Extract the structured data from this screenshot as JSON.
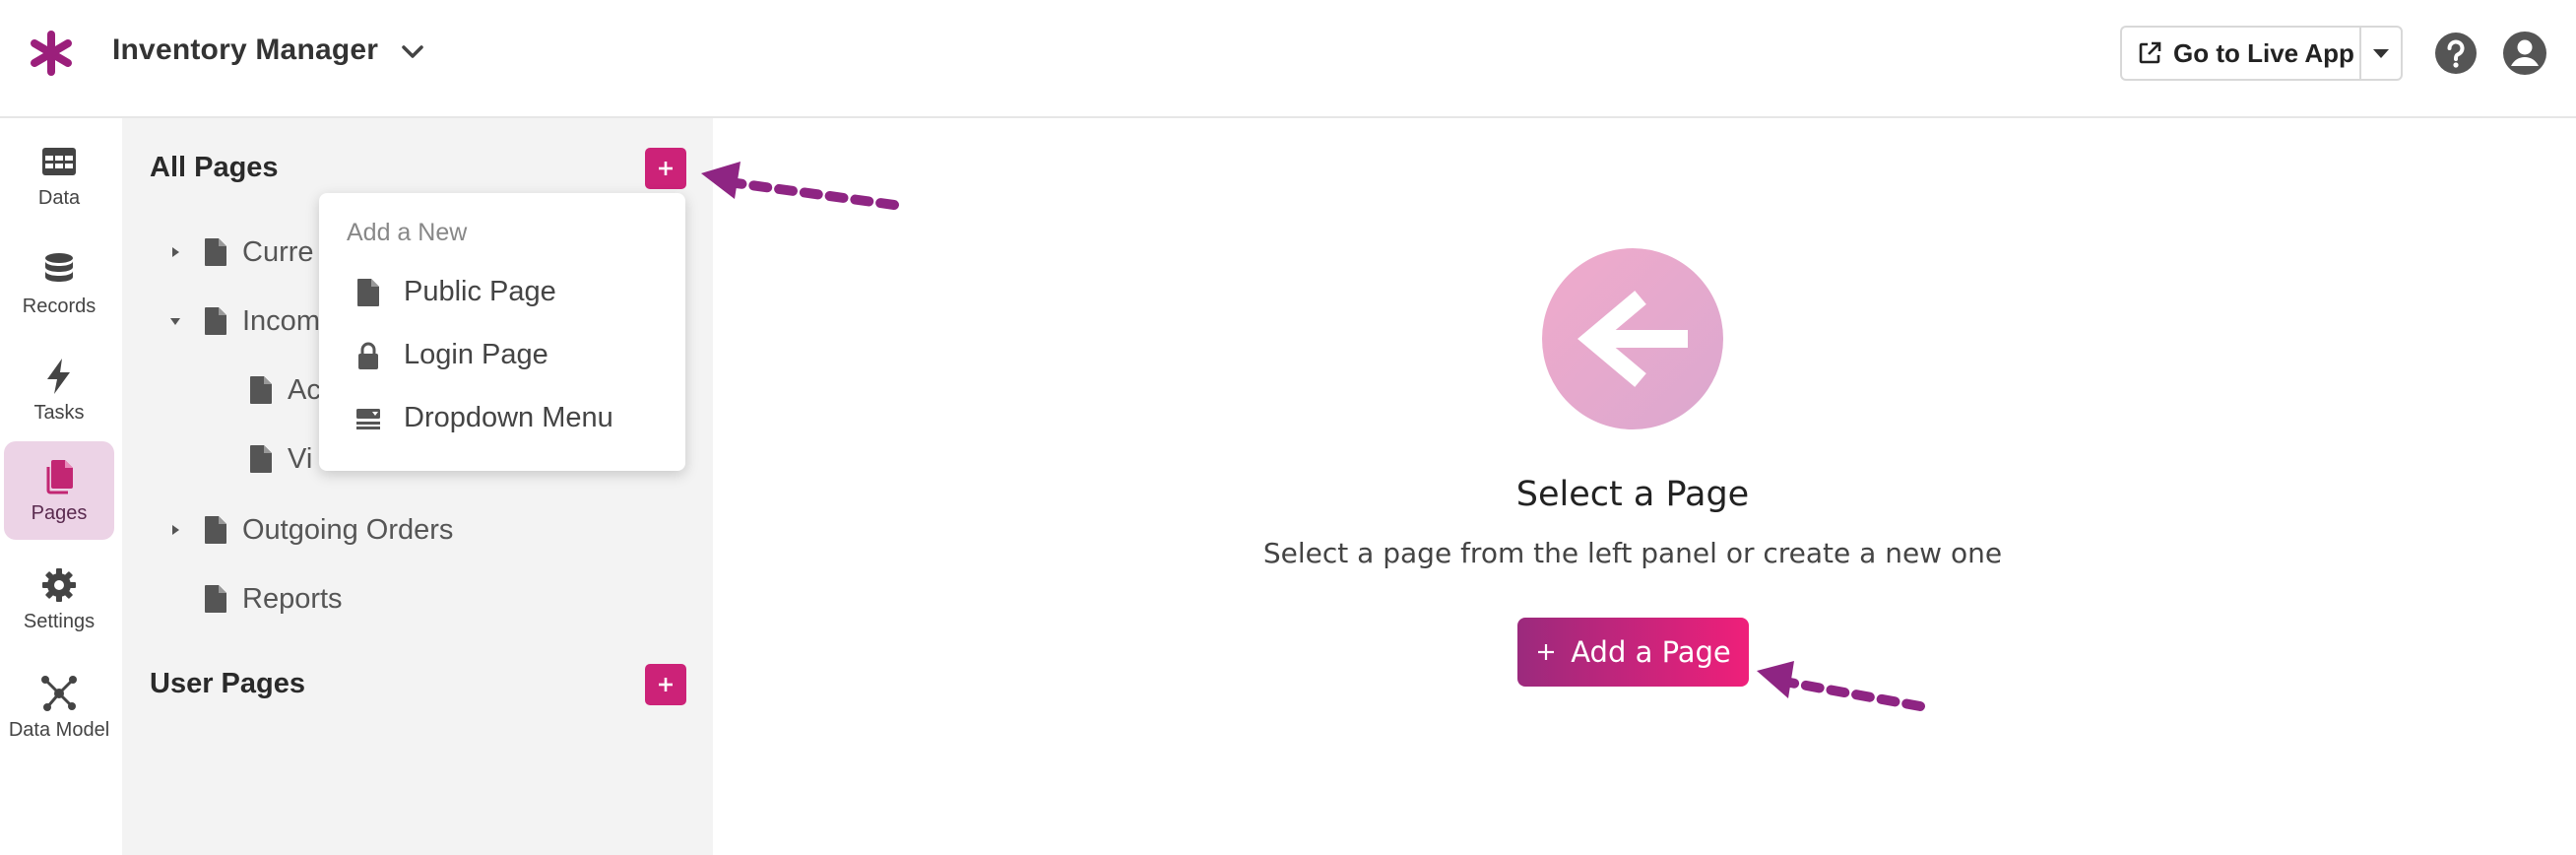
{
  "header": {
    "app_title": "Inventory Manager",
    "live_button_label": "Go to Live App",
    "icons": [
      "asterisk-logo-icon",
      "chevron-down-icon",
      "external-link-icon",
      "caret-down-icon",
      "help-icon",
      "user-account-icon"
    ]
  },
  "leftnav": {
    "items": [
      {
        "label": "Data",
        "icon": "table-icon",
        "active": false
      },
      {
        "label": "Records",
        "icon": "database-icon",
        "active": false
      },
      {
        "label": "Tasks",
        "icon": "bolt-icon",
        "active": false
      },
      {
        "label": "Pages",
        "icon": "pages-icon",
        "active": true
      },
      {
        "label": "Settings",
        "icon": "gear-icon",
        "active": false
      },
      {
        "label": "Data Model",
        "icon": "nodes-icon",
        "active": false
      }
    ]
  },
  "pages_panel": {
    "all_pages_title": "All Pages",
    "user_pages_title": "User Pages",
    "tree": [
      {
        "label": "Curre",
        "expanded": false
      },
      {
        "label": "Incom",
        "expanded": true
      },
      {
        "label": "Ac"
      },
      {
        "label": "Vi"
      },
      {
        "label": "Outgoing Orders",
        "expanded": false
      },
      {
        "label": "Reports"
      }
    ]
  },
  "add_menu": {
    "title": "Add a New",
    "items": [
      {
        "label": "Public Page",
        "icon": "document-icon"
      },
      {
        "label": "Login Page",
        "icon": "lock-icon"
      },
      {
        "label": "Dropdown Menu",
        "icon": "dropdown-menu-icon"
      }
    ]
  },
  "main": {
    "empty_title": "Select a Page",
    "empty_subtitle": "Select a page from the left panel or create a new one",
    "add_button_label": "Add a Page"
  },
  "colors": {
    "brand": "#cc2278",
    "logo": "#9b1f7b",
    "active_nav_bg": "#ecd3e6",
    "panel_bg": "#f3f3f3",
    "annotation_arrow": "#8e2583"
  }
}
